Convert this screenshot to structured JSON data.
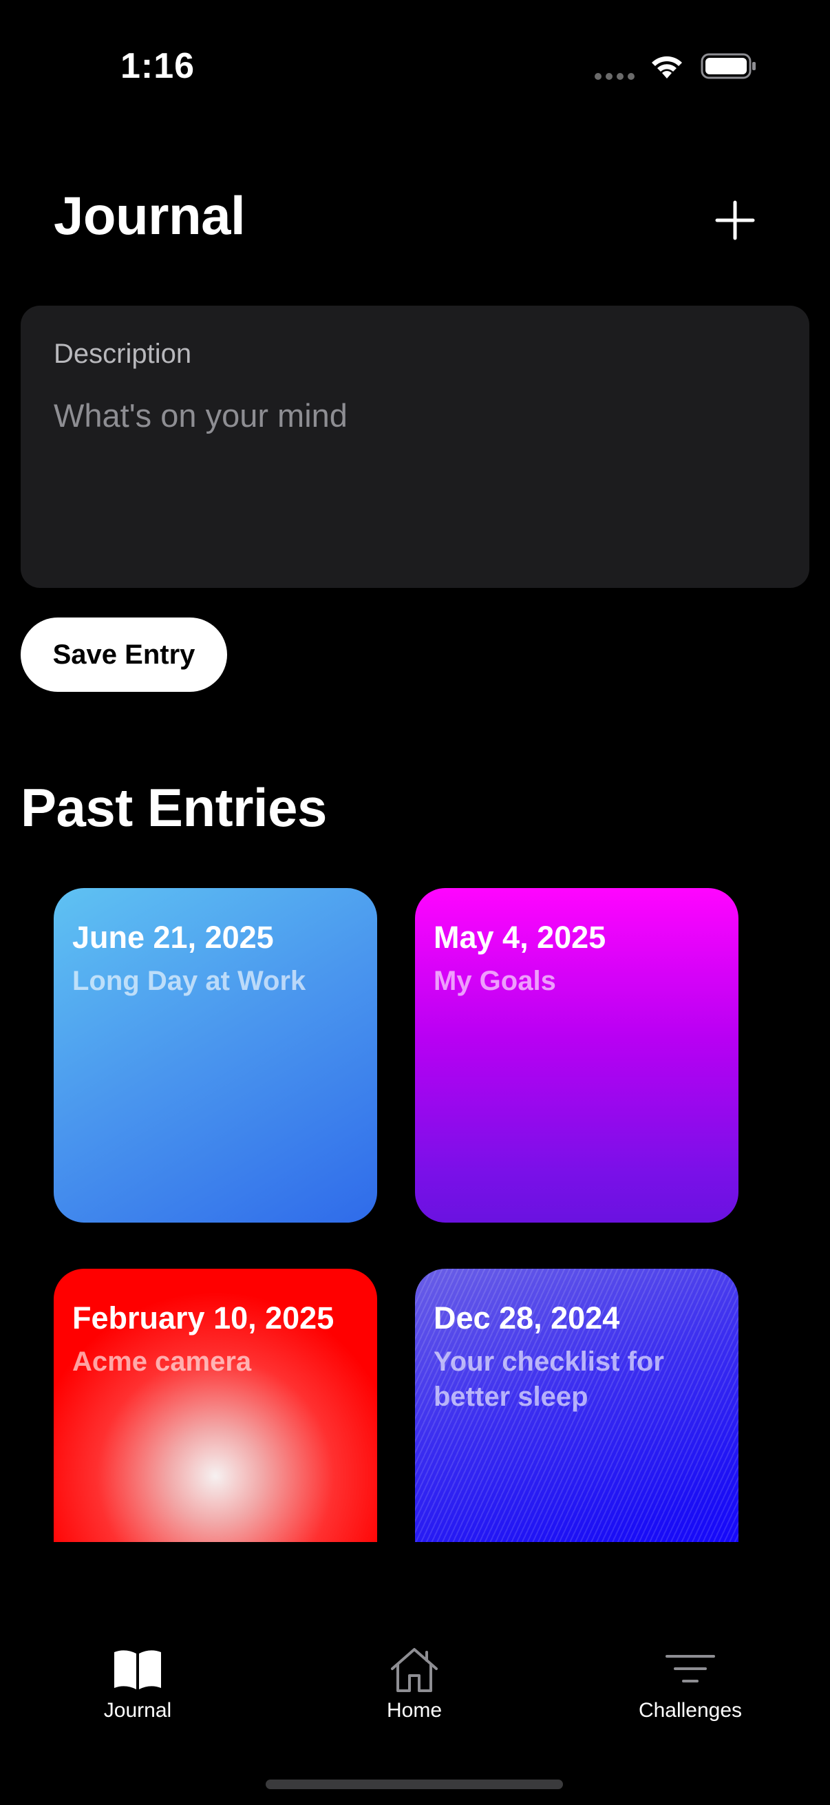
{
  "status_bar": {
    "time": "1:16"
  },
  "header": {
    "title": "Journal",
    "add_icon": "plus-icon"
  },
  "composer": {
    "label": "Description",
    "placeholder": "What's on your mind",
    "value": "",
    "save_label": "Save Entry"
  },
  "past": {
    "title": "Past Entries",
    "entries": [
      {
        "date": "June 21, 2025",
        "title": "Long Day at Work",
        "colors": [
          "#5fc2f3",
          "#2f6bea"
        ]
      },
      {
        "date": "May 4, 2025",
        "title": "My Goals",
        "colors": [
          "#ff05ff",
          "#6a12e0"
        ]
      },
      {
        "date": "February 10, 2025",
        "title": "Acme camera",
        "colors": [
          "#ff0000",
          "#f6f1f1"
        ]
      },
      {
        "date": "Dec 28, 2024",
        "title": "Your checklist for better sleep",
        "colors": [
          "#6a5fe6",
          "#1000ff"
        ]
      }
    ]
  },
  "tabbar": {
    "items": [
      {
        "label": "Journal",
        "icon": "book-icon",
        "active": true
      },
      {
        "label": "Home",
        "icon": "house-icon",
        "active": false
      },
      {
        "label": "Challenges",
        "icon": "filter-icon",
        "active": false
      }
    ]
  }
}
